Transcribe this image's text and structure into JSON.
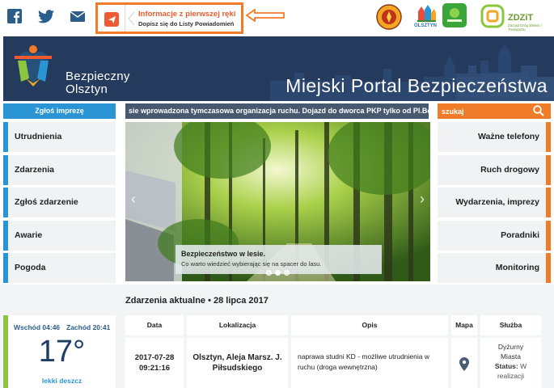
{
  "notification": {
    "title": "Informacje z pierwszej ręki",
    "subtitle": "Dopisz się do Listy Powiadomień"
  },
  "social": {
    "icons": [
      "facebook-icon",
      "twitter-icon",
      "mail-icon"
    ]
  },
  "partners": {
    "olsztyn_label": "OLSZTYN",
    "zdzit_label": "ZDZiT",
    "zdzit_sub": "Zarząd Dróg Zieleni i Transportu"
  },
  "brand": {
    "line1": "Bezpieczny",
    "line2": "Olsztyn"
  },
  "portal_title": "Miejski Portal Bezpieczeństwa",
  "report_button": "Zgłoś imprezę",
  "ticker": "sie wprowadzona tymczasowa organizacja ruchu. Dojazd do dworca PKP tylko od Pl.Bem",
  "search": {
    "placeholder": "szukaj"
  },
  "left_nav": [
    "Utrudnienia",
    "Zdarzenia",
    "Zgłoś zdarzenie",
    "Awarie",
    "Pogoda"
  ],
  "right_nav": [
    "Ważne telefony",
    "Ruch drogowy",
    "Wydarzenia, imprezy",
    "Poradniki",
    "Monitoring"
  ],
  "slide": {
    "title": "Bezpieczeństwo w lesie.",
    "text": "Co warto wiedzieć wybierając się na spacer do lasu.",
    "dots": 3,
    "active_dot": 1
  },
  "weather": {
    "sunrise": "Wschód 04:46",
    "sunset": "Zachód 20:41",
    "temperature": "17°",
    "description": "lekki deszcz"
  },
  "events": {
    "title": "Zdarzenia aktualne  •  28 lipca 2017",
    "columns": [
      "Data",
      "Lokalizacja",
      "Opis",
      "Mapa",
      "Służba"
    ],
    "row": {
      "date": "2017-07-28",
      "time": "09:21:16",
      "location": "Olsztyn, Aleja Marsz. J. Piłsudskiego",
      "description": "naprawa studni KD - możliwe utrudnienia w ruchu (droga wewnętrzna)",
      "service": "Dyżurny Miasta",
      "status_label": "Status:",
      "status_value": "W realizacji"
    }
  },
  "colors": {
    "accent_blue": "#2a95d4",
    "accent_orange": "#f07c2a",
    "banner_navy": "#253b5e",
    "weather_green": "#8cc63f"
  }
}
